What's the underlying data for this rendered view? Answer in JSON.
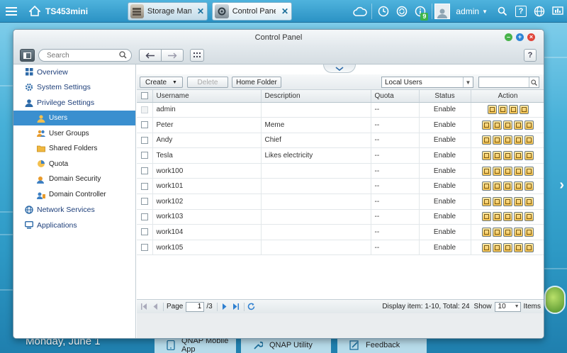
{
  "taskbar": {
    "host_name": "TS453mini",
    "apps": [
      {
        "label": "Storage Mana...",
        "close": "✕"
      },
      {
        "label": "Control Panel",
        "close": "✕"
      }
    ],
    "notification_count": "9",
    "user": "admin",
    "help": "?"
  },
  "desktop": {
    "date": "Monday, June 1",
    "dock": [
      "QNAP Mobile App",
      "QNAP Utility",
      "Feedback"
    ]
  },
  "window": {
    "title": "Control Panel",
    "search_placeholder": "Search",
    "help": "?"
  },
  "sidebar": {
    "items": [
      {
        "label": "Overview",
        "icon": "grid-icon"
      },
      {
        "label": "System Settings",
        "icon": "gear-icon"
      },
      {
        "label": "Privilege Settings",
        "icon": "user-icon"
      },
      {
        "label": "Users",
        "icon": "users-icon",
        "selected": true
      },
      {
        "label": "User Groups",
        "icon": "group-icon"
      },
      {
        "label": "Shared Folders",
        "icon": "folder-icon"
      },
      {
        "label": "Quota",
        "icon": "pie-icon"
      },
      {
        "label": "Domain Security",
        "icon": "shield-icon"
      },
      {
        "label": "Domain Controller",
        "icon": "server-icon"
      },
      {
        "label": "Network Services",
        "icon": "globe-icon"
      },
      {
        "label": "Applications",
        "icon": "apps-icon"
      }
    ]
  },
  "toolbar": {
    "create": "Create",
    "delete": "Delete",
    "home_folder": "Home Folder",
    "filter": "Local Users"
  },
  "table": {
    "headers": [
      "Username",
      "Description",
      "Quota",
      "Status",
      "Action"
    ],
    "rows": [
      {
        "username": "admin",
        "description": "",
        "quota": "--",
        "status": "Enable"
      },
      {
        "username": "Peter",
        "description": "Meme",
        "quota": "--",
        "status": "Enable"
      },
      {
        "username": "Andy",
        "description": "Chief",
        "quota": "--",
        "status": "Enable"
      },
      {
        "username": "Tesla",
        "description": "Likes electricity",
        "quota": "--",
        "status": "Enable"
      },
      {
        "username": "work100",
        "description": "",
        "quota": "--",
        "status": "Enable"
      },
      {
        "username": "work101",
        "description": "",
        "quota": "--",
        "status": "Enable"
      },
      {
        "username": "work102",
        "description": "",
        "quota": "--",
        "status": "Enable"
      },
      {
        "username": "work103",
        "description": "",
        "quota": "--",
        "status": "Enable"
      },
      {
        "username": "work104",
        "description": "",
        "quota": "--",
        "status": "Enable"
      },
      {
        "username": "work105",
        "description": "",
        "quota": "--",
        "status": "Enable"
      }
    ]
  },
  "pager": {
    "page_label": "Page",
    "page": "1",
    "total_pages": "/3",
    "display_info": "Display item: 1-10, Total: 24",
    "show_label": "Show",
    "show_value": "10",
    "items_label": "Items"
  },
  "colors": {
    "accent": "#3a8fcf",
    "taskbar": "#2b92c4"
  }
}
